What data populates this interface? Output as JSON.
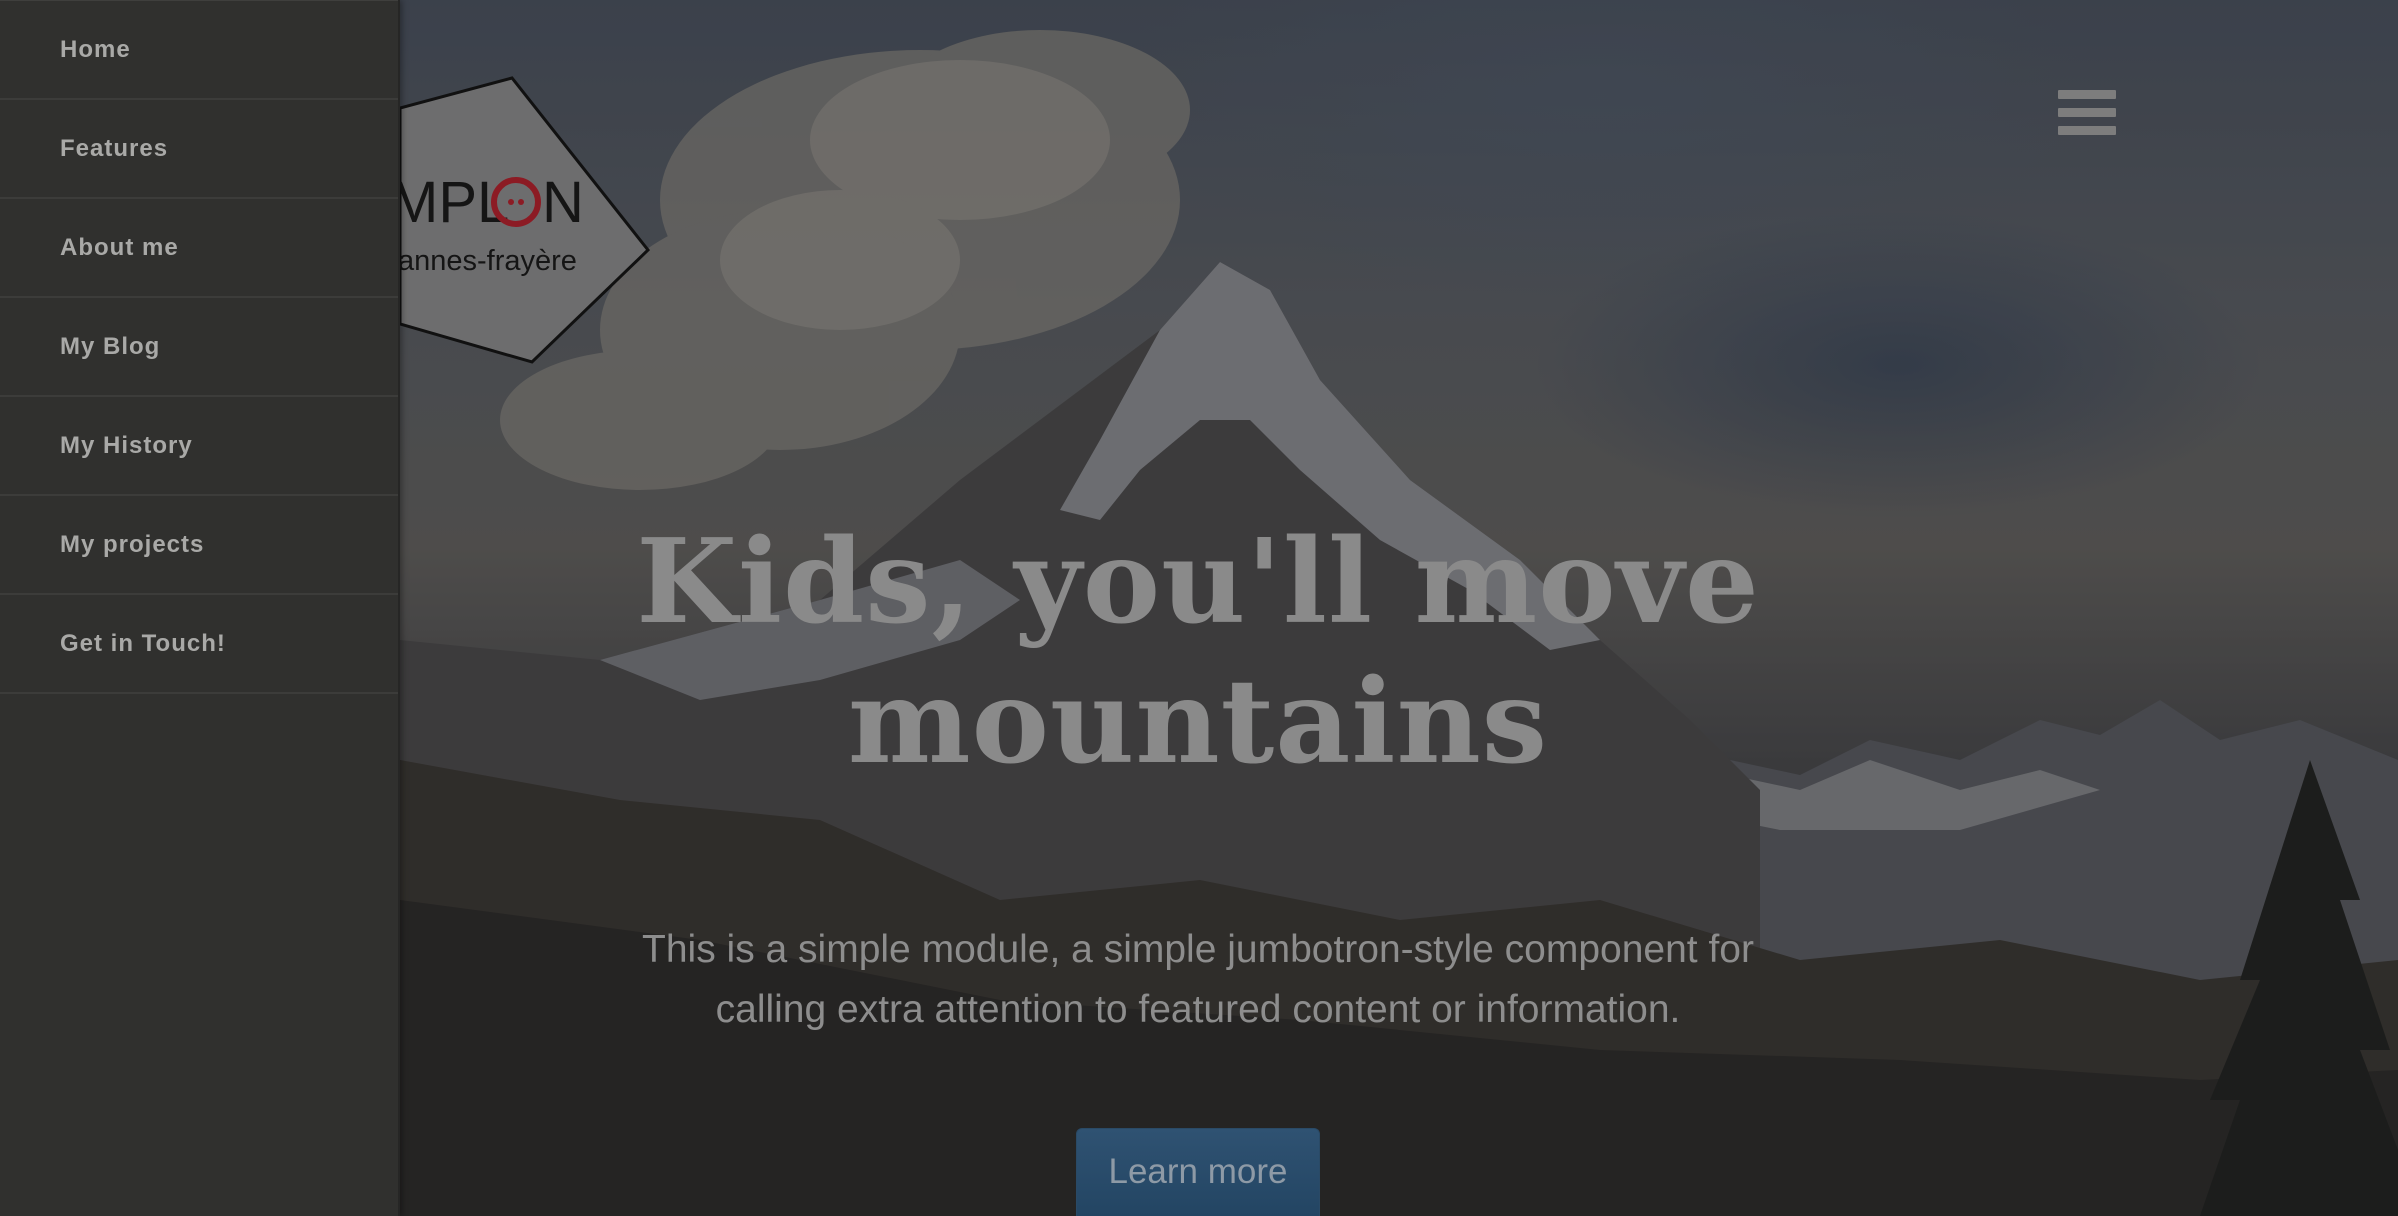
{
  "sidebar": {
    "items": [
      {
        "label": "Home"
      },
      {
        "label": "Features"
      },
      {
        "label": "About me"
      },
      {
        "label": "My Blog"
      },
      {
        "label": "My History"
      },
      {
        "label": "My projects"
      },
      {
        "label": "Get in Touch!"
      }
    ]
  },
  "logo": {
    "line1": "MPL",
    "line1_end": "N",
    "line2": "annes-frayère"
  },
  "header": {
    "menu_icon": "hamburger-menu-icon"
  },
  "jumbotron": {
    "title_line1": "Kids, you'll move",
    "title_line2": "mountains",
    "lead_line1": "This is a simple module, a simple jumbotron-style component for",
    "lead_line2": "calling extra attention to featured content or information.",
    "button_label": "Learn more"
  },
  "colors": {
    "sidebar_bg": "#30302e",
    "sidebar_text": "#a9a9a7",
    "button_bg": "#2f5272",
    "logo_red": "#b0212b"
  }
}
